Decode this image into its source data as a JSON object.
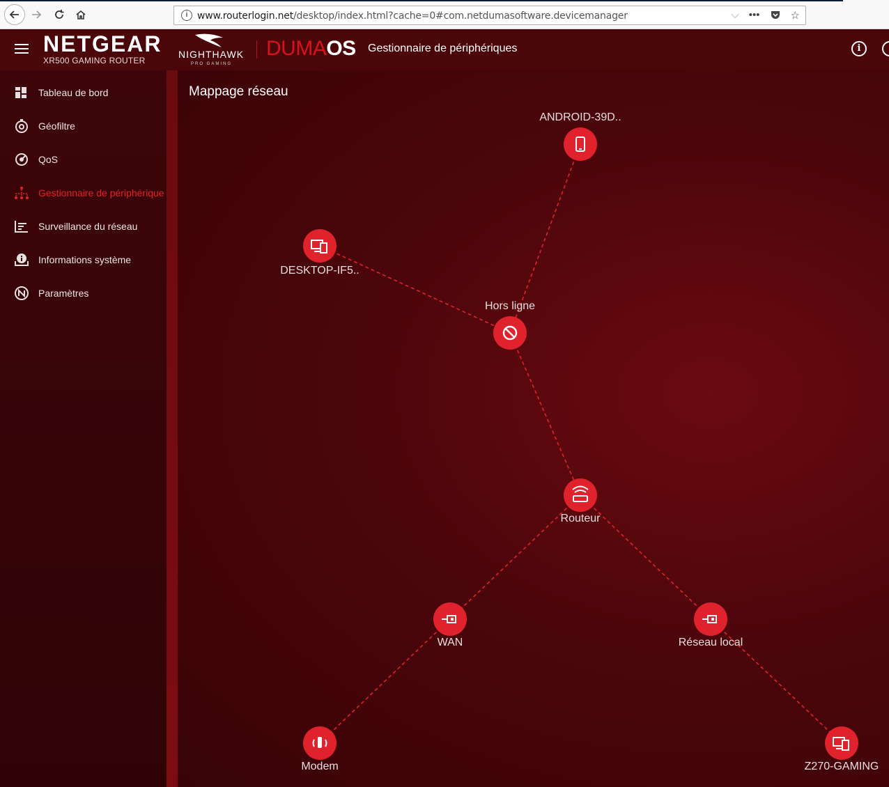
{
  "browser": {
    "url_domain": "www.routerlogin.net",
    "url_path": "/desktop/index.html?cache=0#com.netdumasoftware.devicemanager",
    "menu_label": "•••"
  },
  "header": {
    "brand": "NETGEAR",
    "model": "XR500 GAMING ROUTER",
    "nighthawk": "NIGHTHAWK",
    "nighthawk_sub": "PRO GAMING",
    "duma_light": "DUMA",
    "duma_bold": "OS",
    "page_title": "Gestionnaire de périphériques"
  },
  "sidebar": {
    "items": [
      {
        "label": "Tableau de bord",
        "icon": "dashboard-icon"
      },
      {
        "label": "Géofiltre",
        "icon": "geofilter-icon"
      },
      {
        "label": "QoS",
        "icon": "qos-icon"
      },
      {
        "label": "Gestionnaire de périphériques",
        "icon": "device-manager-icon",
        "active": true
      },
      {
        "label": "Surveillance du réseau",
        "icon": "network-monitor-icon"
      },
      {
        "label": "Informations système",
        "icon": "system-info-icon"
      },
      {
        "label": "Paramètres",
        "icon": "settings-icon"
      }
    ]
  },
  "main": {
    "title": "Mappage réseau",
    "nodes": {
      "android": {
        "label": "ANDROID-39D..",
        "icon": "phone-icon"
      },
      "desktop": {
        "label": "DESKTOP-IF5..",
        "icon": "computer-icon"
      },
      "offline": {
        "label": "Hors ligne",
        "icon": "blocked-icon"
      },
      "router": {
        "label": "Routeur",
        "icon": "router-icon"
      },
      "wan": {
        "label": "WAN",
        "icon": "ethernet-icon"
      },
      "lan": {
        "label": "Réseau local",
        "icon": "ethernet-icon"
      },
      "modem": {
        "label": "Modem",
        "icon": "modem-icon"
      },
      "gaming": {
        "label": "Z270-GAMING",
        "icon": "computer-icon"
      }
    }
  },
  "colors": {
    "accent": "#e0222c",
    "header_bg": "#4a0609",
    "sidebar_bg": "#3d0509"
  }
}
